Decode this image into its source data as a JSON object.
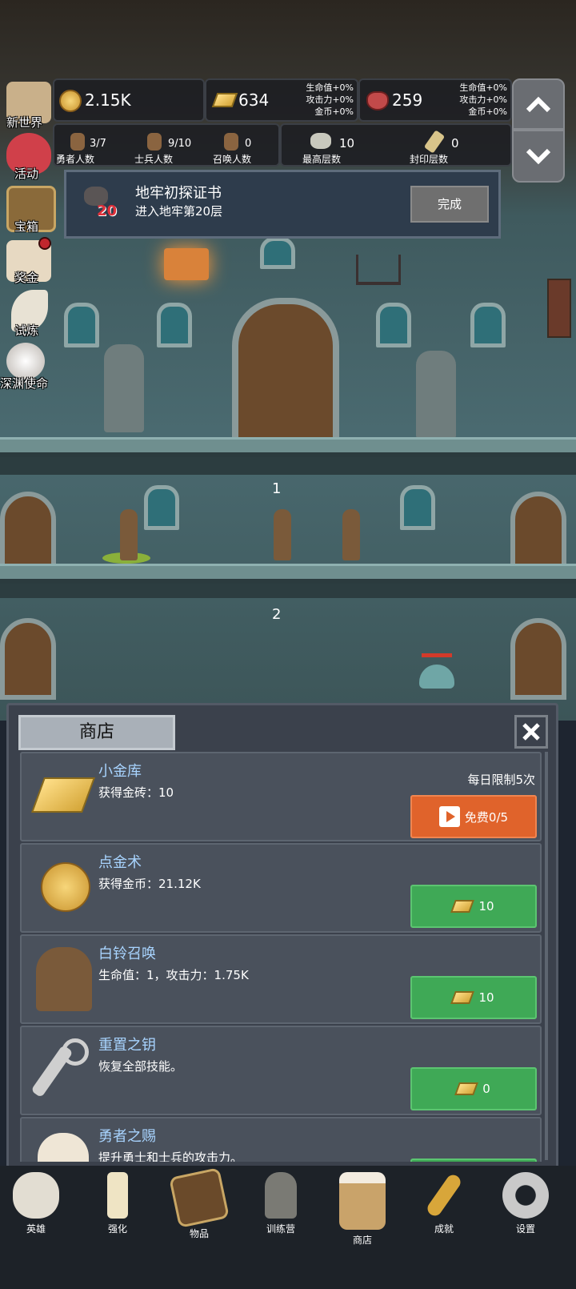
{
  "resources": {
    "gold": "2.15K",
    "gold_bars": "634",
    "gems": "259",
    "bars_bonus": [
      "生命值+0%",
      "攻击力+0%",
      "金币+0%"
    ],
    "gems_bonus": [
      "生命值+0%",
      "攻击力+0%",
      "金币+0%"
    ]
  },
  "counts": [
    {
      "value": "3/7",
      "label": "勇者人数"
    },
    {
      "value": "9/10",
      "label": "士兵人数"
    },
    {
      "value": "0",
      "label": "召唤人数"
    },
    {
      "value": "10",
      "label": "最高层数"
    },
    {
      "value": "0",
      "label": "封印层数"
    }
  ],
  "left_menu": [
    "新世界",
    "活动",
    "宝箱",
    "奖金",
    "试炼",
    "深渊使命"
  ],
  "quest": {
    "title": "地牢初探证书",
    "desc": "进入地牢第20层",
    "badge": "20",
    "button": "完成"
  },
  "floors": [
    "1",
    "2"
  ],
  "shop": {
    "title": "商店",
    "items": [
      {
        "name": "小金库",
        "desc": "获得金砖：10",
        "limit": "每日限制5次",
        "button": "免费0/5",
        "kind": "video"
      },
      {
        "name": "点金术",
        "desc": "获得金币：21.12K",
        "button": "10",
        "kind": "bar"
      },
      {
        "name": "白铃召唤",
        "desc": "生命值：1，攻击力：1.75K",
        "button": "10",
        "kind": "bar"
      },
      {
        "name": "重置之钥",
        "desc": "恢复全部技能。",
        "button": "0",
        "kind": "bar"
      },
      {
        "name": "勇者之赐",
        "desc": "提升勇士和士兵的攻击力。",
        "button": "",
        "kind": "bar"
      }
    ]
  },
  "nav": [
    "英雄",
    "强化",
    "物品",
    "训练营",
    "商店",
    "成就",
    "设置"
  ],
  "colors": {
    "accent_green": "#3fa956",
    "accent_orange": "#e0632b",
    "title_blue": "#a8d4ff",
    "alert_red": "#c0262d"
  }
}
